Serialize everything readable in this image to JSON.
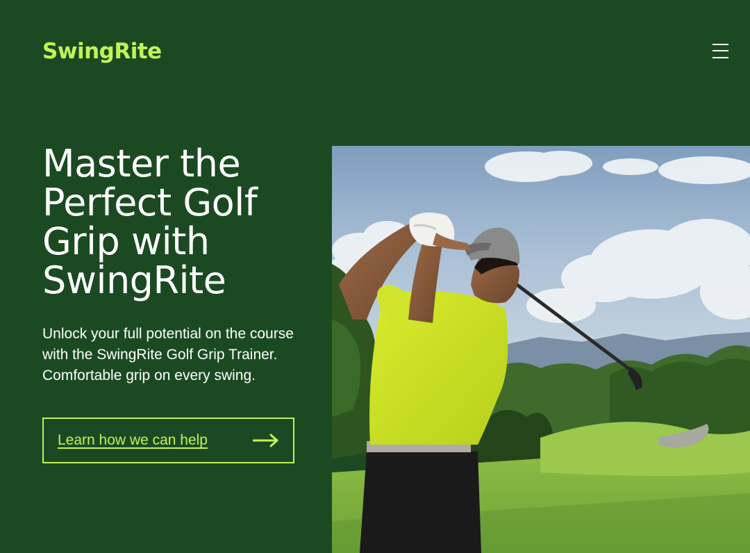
{
  "brand": {
    "name": "SwingRite",
    "accent_color": "#c2f25a",
    "background_color": "#1b4a22"
  },
  "header": {
    "menu_icon": "hamburger-menu-icon"
  },
  "hero": {
    "title": "Master the Perfect Golf Grip with SwingRite",
    "description": "Unlock your full potential on the course with the SwingRite Golf Grip Trainer. Comfortable grip on every swing.",
    "cta_label": "Learn how we can help",
    "cta_icon": "arrow-right-icon"
  }
}
